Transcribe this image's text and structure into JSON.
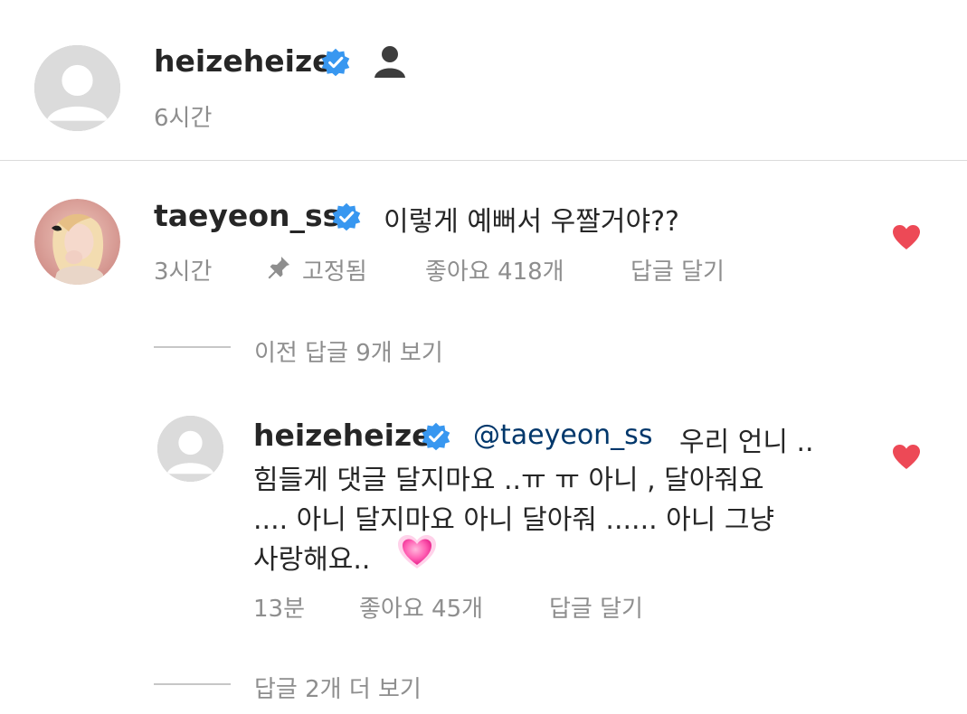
{
  "post": {
    "username": "heizeheize",
    "time": "6시간",
    "icons": [
      "verified-badge",
      "silhouette-emoji"
    ]
  },
  "pinned_comment": {
    "username": "taeyeon_ss",
    "text": "이렇게 예뻐서 우짤거야??",
    "time": "3시간",
    "pinned_label": "고정됨",
    "likes_label": "좋아요 418개",
    "reply_label": "답글 달기",
    "liked": true
  },
  "view_previous_replies": "이전 답글 9개 보기",
  "reply": {
    "username": "heizeheize",
    "mention": "@taeyeon_ss",
    "text_line1": "우리 언니 ..",
    "text_line2": "힘들게 댓글 달지마요 ..ㅠ ㅠ 아니 , 달아줘요",
    "text_line3": ".... 아니 달지마요 아니 달아줘 ...... 아니 그냥",
    "text_line4": "사랑해요..",
    "emoji": "pink-heart-emoji",
    "time": "13분",
    "likes_label": "좋아요 45개",
    "reply_label": "답글 달기",
    "liked": true
  },
  "view_more_replies": "답글 2개 더 보기",
  "colors": {
    "verified": "#3897f0",
    "heart": "#ed4956",
    "meta": "#8e8e8e",
    "text": "#262626"
  }
}
